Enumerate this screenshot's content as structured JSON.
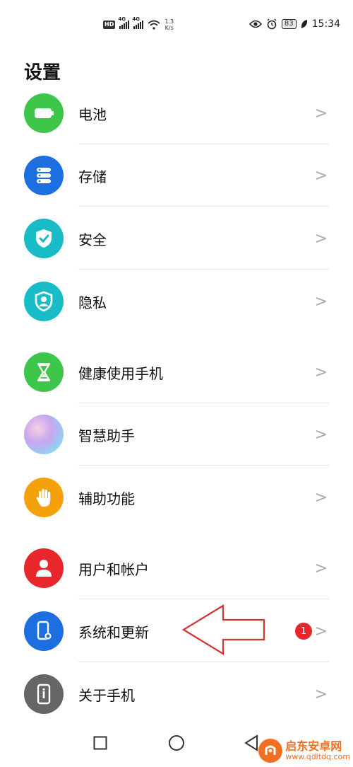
{
  "status_bar": {
    "hd": "HD",
    "sig1": "4G",
    "sig2": "4G",
    "speed_value": "1.3",
    "speed_unit": "K/s",
    "battery": "83",
    "time": "15:34"
  },
  "page": {
    "title": "设置"
  },
  "items": [
    {
      "label": "电池",
      "icon": "battery-icon",
      "color": "#3ec64b"
    },
    {
      "label": "存储",
      "icon": "storage-icon",
      "color": "#1d6fe0"
    },
    {
      "label": "安全",
      "icon": "security-shield-icon",
      "color": "#18bcc6"
    },
    {
      "label": "隐私",
      "icon": "privacy-icon",
      "color": "#18bcc6"
    },
    {
      "label": "健康使用手机",
      "icon": "hourglass-icon",
      "color": "#3ec64b"
    },
    {
      "label": "智慧助手",
      "icon": "assistant-orb-icon",
      "color": "#c7a6f0"
    },
    {
      "label": "辅助功能",
      "icon": "hand-icon",
      "color": "#f5a10c"
    },
    {
      "label": "用户和帐户",
      "icon": "user-icon",
      "color": "#e8262b"
    },
    {
      "label": "系统和更新",
      "icon": "phone-settings-icon",
      "color": "#1d6fe0",
      "badge": "1"
    },
    {
      "label": "关于手机",
      "icon": "phone-info-icon",
      "color": "#666666"
    }
  ],
  "chevron": ">",
  "watermark": {
    "name": "启东安卓网",
    "url": "www.qdltdq.com"
  }
}
